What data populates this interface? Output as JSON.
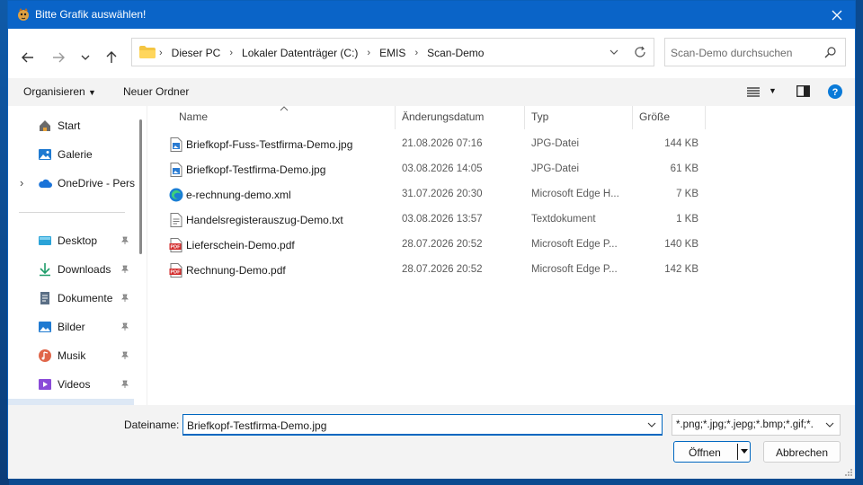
{
  "window": {
    "title": "Bitte Grafik auswählen!"
  },
  "address": {
    "crumbs": [
      "Dieser PC",
      "Lokaler Datenträger (C:)",
      "EMIS",
      "Scan-Demo"
    ]
  },
  "search": {
    "placeholder": "Scan-Demo durchsuchen"
  },
  "toolbar": {
    "organize_label": "Organisieren",
    "new_folder_label": "Neuer Ordner"
  },
  "sidebar": {
    "items": [
      {
        "label": "Start",
        "icon": "home-icon"
      },
      {
        "label": "Galerie",
        "icon": "gallery-icon"
      },
      {
        "label": "OneDrive - Pers",
        "icon": "cloud-icon"
      },
      {
        "label": "Desktop",
        "icon": "desktop-icon"
      },
      {
        "label": "Downloads",
        "icon": "download-icon"
      },
      {
        "label": "Dokumente",
        "icon": "documents-icon"
      },
      {
        "label": "Bilder",
        "icon": "pictures-icon"
      },
      {
        "label": "Musik",
        "icon": "music-icon"
      },
      {
        "label": "Videos",
        "icon": "videos-icon"
      }
    ]
  },
  "columns": {
    "name": "Name",
    "date": "Änderungsdatum",
    "type": "Typ",
    "size": "Größe"
  },
  "files": [
    {
      "name": "Briefkopf-Fuss-Testfirma-Demo.jpg",
      "date": "21.08.2026 07:16",
      "type": "JPG-Datei",
      "size": "144 KB",
      "icon": "image-file-icon"
    },
    {
      "name": "Briefkopf-Testfirma-Demo.jpg",
      "date": "03.08.2026 14:05",
      "type": "JPG-Datei",
      "size": "61 KB",
      "icon": "image-file-icon"
    },
    {
      "name": "e-rechnung-demo.xml",
      "date": "31.07.2026 20:30",
      "type": "Microsoft Edge H...",
      "size": "7 KB",
      "icon": "edge-icon"
    },
    {
      "name": "Handelsregisterauszug-Demo.txt",
      "date": "03.08.2026 13:57",
      "type": "Textdokument",
      "size": "1 KB",
      "icon": "text-file-icon"
    },
    {
      "name": "Lieferschein-Demo.pdf",
      "date": "28.07.2026 20:52",
      "type": "Microsoft Edge P...",
      "size": "140 KB",
      "icon": "pdf-icon"
    },
    {
      "name": "Rechnung-Demo.pdf",
      "date": "28.07.2026 20:52",
      "type": "Microsoft Edge P...",
      "size": "142 KB",
      "icon": "pdf-icon"
    }
  ],
  "footer": {
    "filename_label": "Dateiname:",
    "filename_value": "Briefkopf-Testfirma-Demo.jpg",
    "filter_value": "*.png;*.jpg;*.jepg;*.bmp;*.gif;*.",
    "open_label": "Öffnen",
    "cancel_label": "Abbrechen"
  },
  "colors": {
    "accent": "#0067c0",
    "titlebar": "#0a64c8"
  }
}
